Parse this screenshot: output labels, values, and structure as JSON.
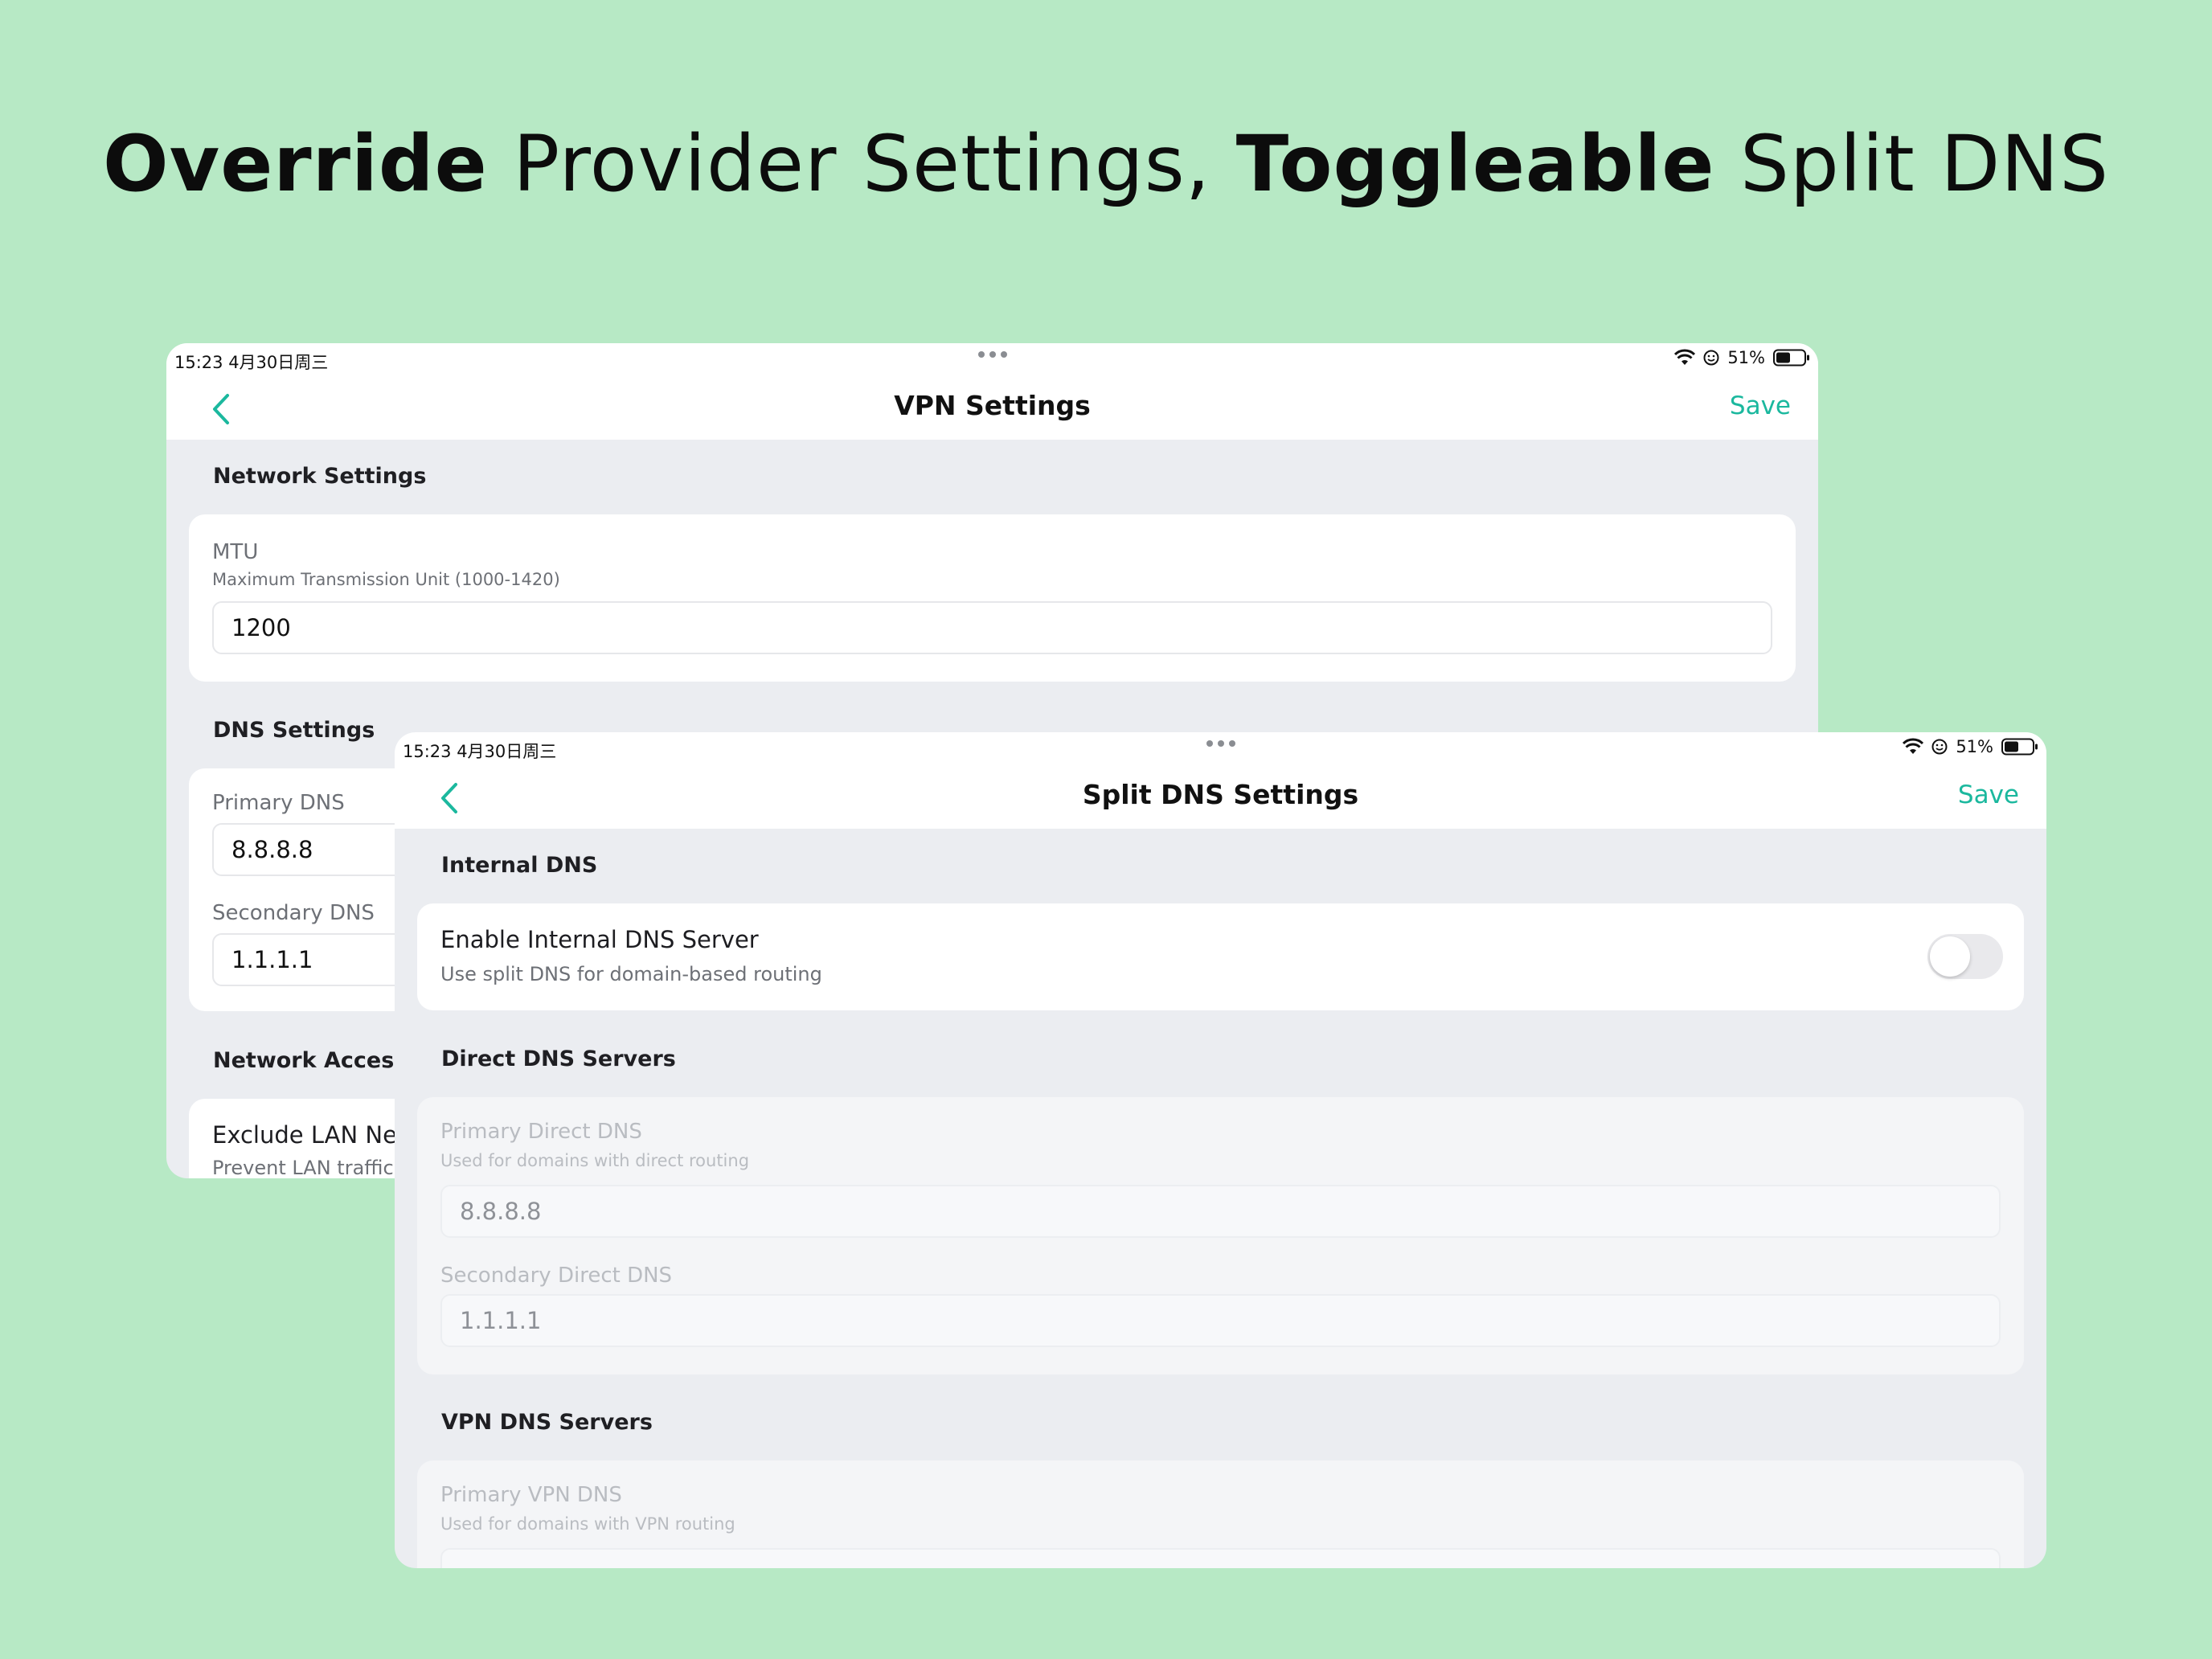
{
  "headline": {
    "part1_bold": "Override",
    "part2": " Provider Settings, ",
    "part3_bold": "Toggleable",
    "part4": " Split DNS"
  },
  "status_bar": {
    "time": "15:23  4月30日周三",
    "battery": "51%"
  },
  "vpn_settings": {
    "title": "VPN Settings",
    "save_label": "Save",
    "network_settings": {
      "section_title": "Network Settings",
      "mtu_label": "MTU",
      "mtu_hint": "Maximum Transmission Unit (1000-1420)",
      "mtu_value": "1200"
    },
    "dns_settings": {
      "section_title": "DNS Settings",
      "primary_label": "Primary DNS",
      "primary_value": "8.8.8.8",
      "secondary_label": "Secondary DNS",
      "secondary_value": "1.1.1.1"
    },
    "network_access": {
      "section_title": "Network Access",
      "exclude_lan_title": "Exclude LAN Net",
      "exclude_lan_sub": "Prevent LAN traffic"
    }
  },
  "split_dns": {
    "title": "Split DNS Settings",
    "save_label": "Save",
    "internal_dns": {
      "section_title": "Internal DNS",
      "enable_title": "Enable Internal DNS Server",
      "enable_sub": "Use split DNS for domain-based routing",
      "enabled": false
    },
    "direct_dns": {
      "section_title": "Direct DNS Servers",
      "primary_label": "Primary Direct DNS",
      "primary_hint": "Used for domains with direct routing",
      "primary_value": "8.8.8.8",
      "secondary_label": "Secondary Direct DNS",
      "secondary_value": "1.1.1.1"
    },
    "vpn_dns": {
      "section_title": "VPN DNS Servers",
      "primary_label": "Primary VPN DNS",
      "primary_hint": "Used for domains with VPN routing"
    }
  },
  "colors": {
    "background": "#b7e9c5",
    "accent": "#1bb89e"
  }
}
